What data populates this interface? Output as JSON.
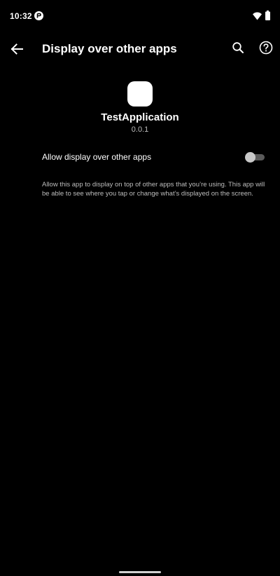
{
  "status_bar": {
    "time": "10:32",
    "icons": [
      "notification-icon",
      "wifi-icon",
      "battery-icon"
    ]
  },
  "app_bar": {
    "title": "Display over other apps",
    "back_icon": "arrow-back-icon",
    "search_icon": "search-icon",
    "help_icon": "help-icon"
  },
  "app": {
    "name": "TestApplication",
    "version": "0.0.1"
  },
  "setting": {
    "label": "Allow display over other apps",
    "enabled": false
  },
  "description": "Allow this app to display on top of other apps that you’re using. This app will be able to see where you tap or change what’s displayed on the screen.",
  "colors": {
    "background": "#000000",
    "text_primary": "#ffffff",
    "text_secondary": "#bdbdbd",
    "switch_thumb_off": "#c8c8c8",
    "switch_track_off": "#5a5a5a"
  }
}
